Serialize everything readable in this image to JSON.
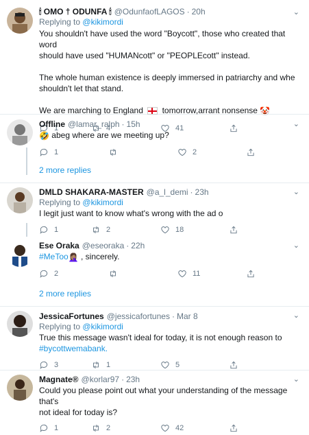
{
  "tweets": [
    {
      "name": "🕯 OMO † ODUNFA 🕯",
      "handle": "@OdunfaofLAGOS",
      "time": "20h",
      "reply_to_prefix": "Replying to",
      "reply_to": "@kikimordi",
      "lines": [
        "You shouldn't have used the word \"Boycott\", those who created that word",
        "should have used \"HUMANcott\" or \"PEOPLEcott\" instead.",
        "",
        "The whole human existence is deeply immersed in patriarchy and whe",
        "shouldn't let that stand.",
        "",
        "We are marching to England",
        "tomorrow,arrant nonsense"
      ],
      "replies": "1",
      "retweets": "4",
      "likes": "41"
    },
    {
      "name": "Offline",
      "handle": "@lamar_ralph",
      "time": "15h",
      "text": "abeg where are we meeting up?",
      "replies": "1",
      "retweets": "",
      "likes": "2"
    },
    {
      "name": "DMLD SHAKARA-MASTER",
      "handle": "@a_l_demi",
      "time": "23h",
      "reply_to_prefix": "Replying to",
      "reply_to": "@kikimordi",
      "text": "I legit just want to know what's wrong with the ad o",
      "replies": "1",
      "retweets": "2",
      "likes": "18"
    },
    {
      "name": "Ese Oraka",
      "handle": "@eseoraka",
      "time": "22h",
      "hashtag": "#MeToo",
      "text": ", sincerely.",
      "replies": "2",
      "retweets": "",
      "likes": "11"
    },
    {
      "name": "JessicaFortunes",
      "handle": "@jessicafortunes",
      "time": "Mar 8",
      "reply_to_prefix": "Replying to",
      "reply_to": "@kikimordi",
      "text": "True this message wasn't ideal for today, it is not enough reason to",
      "hashtag": "#bycottwemabank.",
      "replies": "3",
      "retweets": "1",
      "likes": "5"
    },
    {
      "name": "Magnate®",
      "handle": "@korlar97",
      "time": "23h",
      "lines": [
        "Could you please point out what your understanding of the message that's",
        "not ideal for today is?"
      ],
      "replies": "1",
      "retweets": "2",
      "likes": "42"
    }
  ],
  "more_replies_label": "2 more replies",
  "dot": "·",
  "colors": {
    "link": "#1b95e0",
    "muted": "#657786",
    "divider": "#e6ecf0"
  }
}
